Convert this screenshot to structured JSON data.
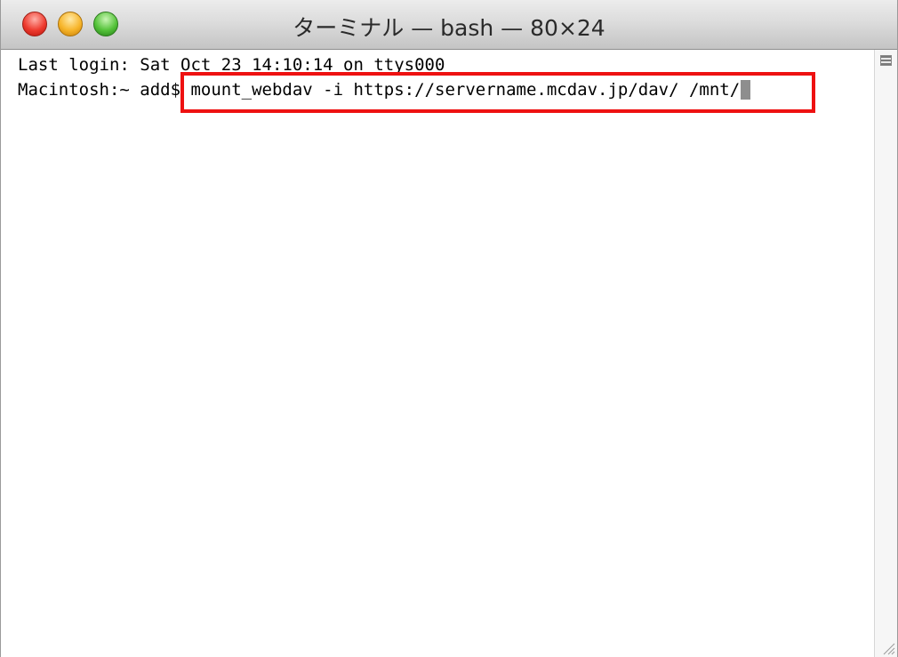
{
  "window": {
    "title": "ターミナル — bash — 80×24"
  },
  "traffic_lights": [
    {
      "name": "close-button",
      "color": "#ee3b2f"
    },
    {
      "name": "minimize-button",
      "color": "#f7b52a"
    },
    {
      "name": "zoom-button",
      "color": "#55c33a"
    }
  ],
  "terminal": {
    "line1": "Last login: Sat Oct 23 14:10:14 on ttys000",
    "prompt": "Macintosh:~ add$ ",
    "command": "mount_webdav -i https://servername.mcdav.jp/dav/ /mnt/"
  },
  "highlight": {
    "color": "#ee1111"
  },
  "icons": {
    "split_pane": "split-pane-icon",
    "resize": "resize-grip-icon"
  }
}
